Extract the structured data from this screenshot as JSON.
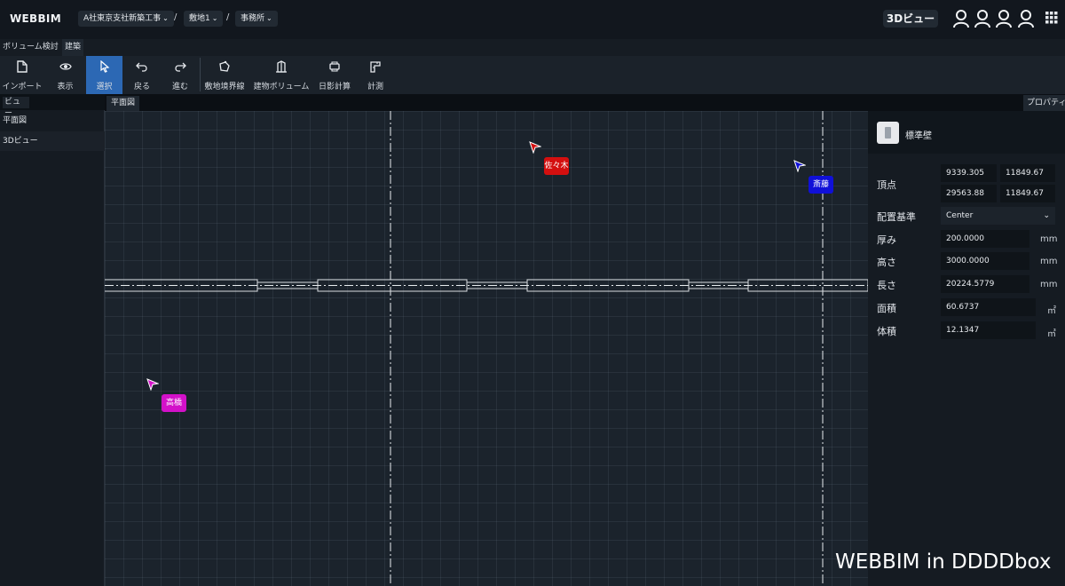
{
  "app": {
    "logo": "WEBBIM",
    "breadcrumbs": [
      "A社東京支社新築工事",
      "敷地1",
      "事務所"
    ],
    "view3d_button": "3Dビュー"
  },
  "tabs": [
    "ボリューム検討",
    "建築"
  ],
  "toolbar": {
    "tools": [
      {
        "label": "インポート",
        "icon": "file-icon"
      },
      {
        "label": "表示",
        "icon": "eye-icon"
      },
      {
        "label": "選択",
        "icon": "pointer-icon",
        "active": true
      },
      {
        "label": "戻る",
        "icon": "undo-icon"
      },
      {
        "label": "進む",
        "icon": "redo-icon"
      },
      {
        "label": "敷地境界線",
        "icon": "site-boundary-icon"
      },
      {
        "label": "建物ボリューム",
        "icon": "building-icon"
      },
      {
        "label": "日影計算",
        "icon": "shadow-calc-icon"
      },
      {
        "label": "計測",
        "icon": "measure-icon"
      }
    ]
  },
  "left_panel": {
    "header": "ビュー",
    "items": [
      "平面図",
      "3Dビュー"
    ]
  },
  "canvas": {
    "tab": "平面図",
    "cursors": [
      {
        "name": "佐々木",
        "color": "#d40f0f"
      },
      {
        "name": "斎藤",
        "color": "#1010d8"
      },
      {
        "name": "高橋",
        "color": "#d311c9"
      }
    ]
  },
  "properties": {
    "tab": "プロパティ",
    "title": "標準壁",
    "vertex_label": "頂点",
    "vertex_values": [
      "9339.305",
      "11849.67",
      "29563.88",
      "11849.67"
    ],
    "placement_label": "配置基準",
    "placement_value": "Center",
    "thickness_label": "厚み",
    "thickness_value": "200.0000",
    "thickness_unit": "mm",
    "height_label": "高さ",
    "height_value": "3000.0000",
    "height_unit": "mm",
    "length_label": "長さ",
    "length_value": "20224.5779",
    "length_unit": "mm",
    "area_label": "面積",
    "area_value": "60.6737",
    "area_unit": "㎡",
    "volume_label": "体積",
    "volume_value": "12.1347",
    "volume_unit": "㎥"
  },
  "colors": {
    "accent": "#2c68b4",
    "background": "#1b232c"
  },
  "watermark": "WEBBIM in DDDDbox"
}
